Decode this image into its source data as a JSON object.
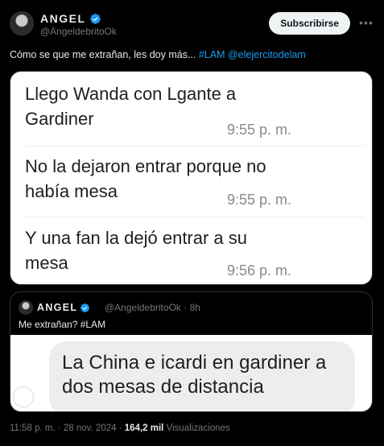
{
  "author": {
    "display_name": "ANGEL",
    "handle": "@AngeldebritoOk",
    "verified_badge_color": "#1d9bf0"
  },
  "subscribe_label": "Subscribirse",
  "more_icon": "more-horizontal-icon",
  "tweet": {
    "text": "Cómo se que me extrañan, les doy más... ",
    "hashtag": "#LAM",
    "mention": "@elejercitodelam"
  },
  "chat_messages": [
    {
      "text": "Llego Wanda con Lgante a Gardiner",
      "time": "9:55 p. m."
    },
    {
      "text": "No la dejaron entrar porque no había mesa",
      "time": "9:55 p. m."
    },
    {
      "text": "Y una fan la dejó entrar a su mesa",
      "time": "9:56 p. m."
    }
  ],
  "quote": {
    "display_name": "ANGEL",
    "handle_time": "@AngeldebritoOk · 8h",
    "text": "Me extrañan? #LAM",
    "bubble_text": "La China e icardi en gardiner a dos mesas de distancia"
  },
  "meta": {
    "timestamp": "11:58 p. m. · 28 nov. 2024 · ",
    "views_count": "164,2 mil",
    "views_label": " Visualizaciones"
  },
  "colors": {
    "background": "#000000",
    "text": "#e7e9ea",
    "muted": "#71767b",
    "link": "#1d9bf0"
  }
}
